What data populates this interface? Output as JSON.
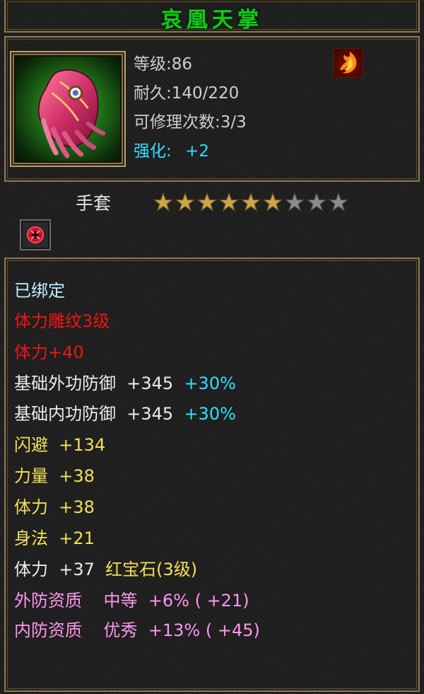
{
  "item": {
    "name": "哀凰天掌",
    "level": "等级:86",
    "durability": "耐久:140/220",
    "repair": "可修理次数:3/3",
    "enhance_label": "强化:",
    "enhance_value": "+2",
    "type": "手套",
    "stars_filled": 6,
    "stars_total": 9,
    "element_icon": "fire-icon",
    "item_icon": "glove-icon",
    "gem_slot_icon": "red-gem-icon"
  },
  "stats": [
    {
      "parts": [
        {
          "text": "已绑定",
          "color": "#bff2ff"
        }
      ]
    },
    {
      "parts": [
        {
          "text": "体力雕纹3级",
          "color": "#f01414"
        }
      ]
    },
    {
      "parts": [
        {
          "text": "体力+40",
          "color": "#f01414"
        }
      ]
    },
    {
      "parts": [
        {
          "text": "基础外功防御  +345",
          "color": "#ececec"
        },
        {
          "text": "  +30%",
          "color": "#2fe0ff"
        }
      ]
    },
    {
      "parts": [
        {
          "text": "基础内功防御  +345",
          "color": "#ececec"
        },
        {
          "text": "  +30%",
          "color": "#2fe0ff"
        }
      ]
    },
    {
      "parts": [
        {
          "text": "闪避  +134",
          "color": "#f2e05a"
        }
      ]
    },
    {
      "parts": [
        {
          "text": "力量  +38",
          "color": "#f2e05a"
        }
      ]
    },
    {
      "parts": [
        {
          "text": "体力  +38",
          "color": "#f2e05a"
        }
      ]
    },
    {
      "parts": [
        {
          "text": "身法  +21",
          "color": "#f2e05a"
        }
      ]
    },
    {
      "parts": [
        {
          "text": "体力  +37",
          "color": "#ececec"
        },
        {
          "text": "  红宝石(3级)",
          "color": "#f2e05a"
        }
      ]
    },
    {
      "parts": [
        {
          "text": "外防资质    中等  +6% ( +21)",
          "color": "#ff96ee"
        }
      ]
    },
    {
      "parts": [
        {
          "text": "内防资质    优秀  +13% ( +45)",
          "color": "#ff96ee"
        }
      ]
    }
  ]
}
